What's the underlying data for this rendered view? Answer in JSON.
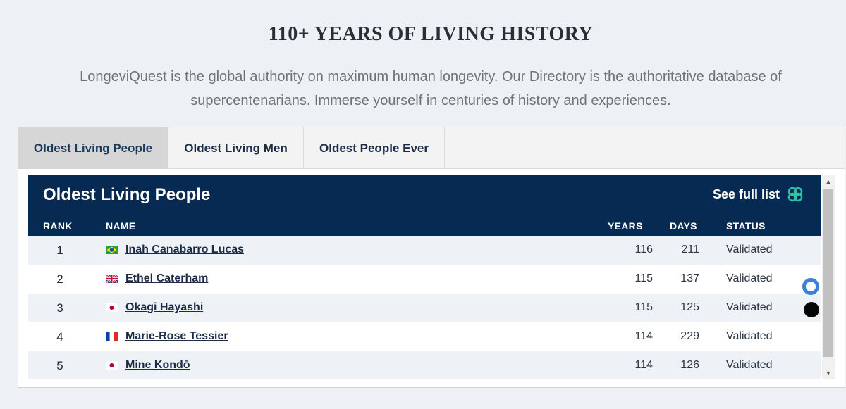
{
  "hero": {
    "headline": "110+ YEARS OF LIVING HISTORY",
    "intro": "LongeviQuest is the global authority on maximum human longevity.  Our Directory is the authoritative database of supercentenarians.  Immerse yourself in centuries of history and experiences."
  },
  "tabs": [
    {
      "label": "Oldest Living People",
      "active": true
    },
    {
      "label": "Oldest Living Men",
      "active": false
    },
    {
      "label": "Oldest People Ever",
      "active": false
    }
  ],
  "table": {
    "title": "Oldest Living People",
    "full_list_label": "See full list",
    "full_list_icon": "clover-icon",
    "accent_color": "#2fc4a3",
    "header_bg": "#062a52",
    "columns": {
      "rank": "RANK",
      "name": "NAME",
      "years": "YEARS",
      "days": "DAYS",
      "status": "STATUS"
    },
    "rows": [
      {
        "rank": "1",
        "flag": "brazil-flag-icon",
        "name": "Inah Canabarro Lucas",
        "years": "116",
        "days": "211",
        "status": "Validated"
      },
      {
        "rank": "2",
        "flag": "uk-flag-icon",
        "name": "Ethel Caterham",
        "years": "115",
        "days": "137",
        "status": "Validated"
      },
      {
        "rank": "3",
        "flag": "japan-flag-icon",
        "name": "Okagi Hayashi",
        "years": "115",
        "days": "125",
        "status": "Validated"
      },
      {
        "rank": "4",
        "flag": "france-flag-icon",
        "name": "Marie-Rose Tessier",
        "years": "114",
        "days": "229",
        "status": "Validated"
      },
      {
        "rank": "5",
        "flag": "japan-flag-icon",
        "name": "Mine Kondō",
        "years": "114",
        "days": "126",
        "status": "Validated"
      }
    ]
  },
  "scroll": {
    "up_glyph": "▲",
    "down_glyph": "▼"
  }
}
